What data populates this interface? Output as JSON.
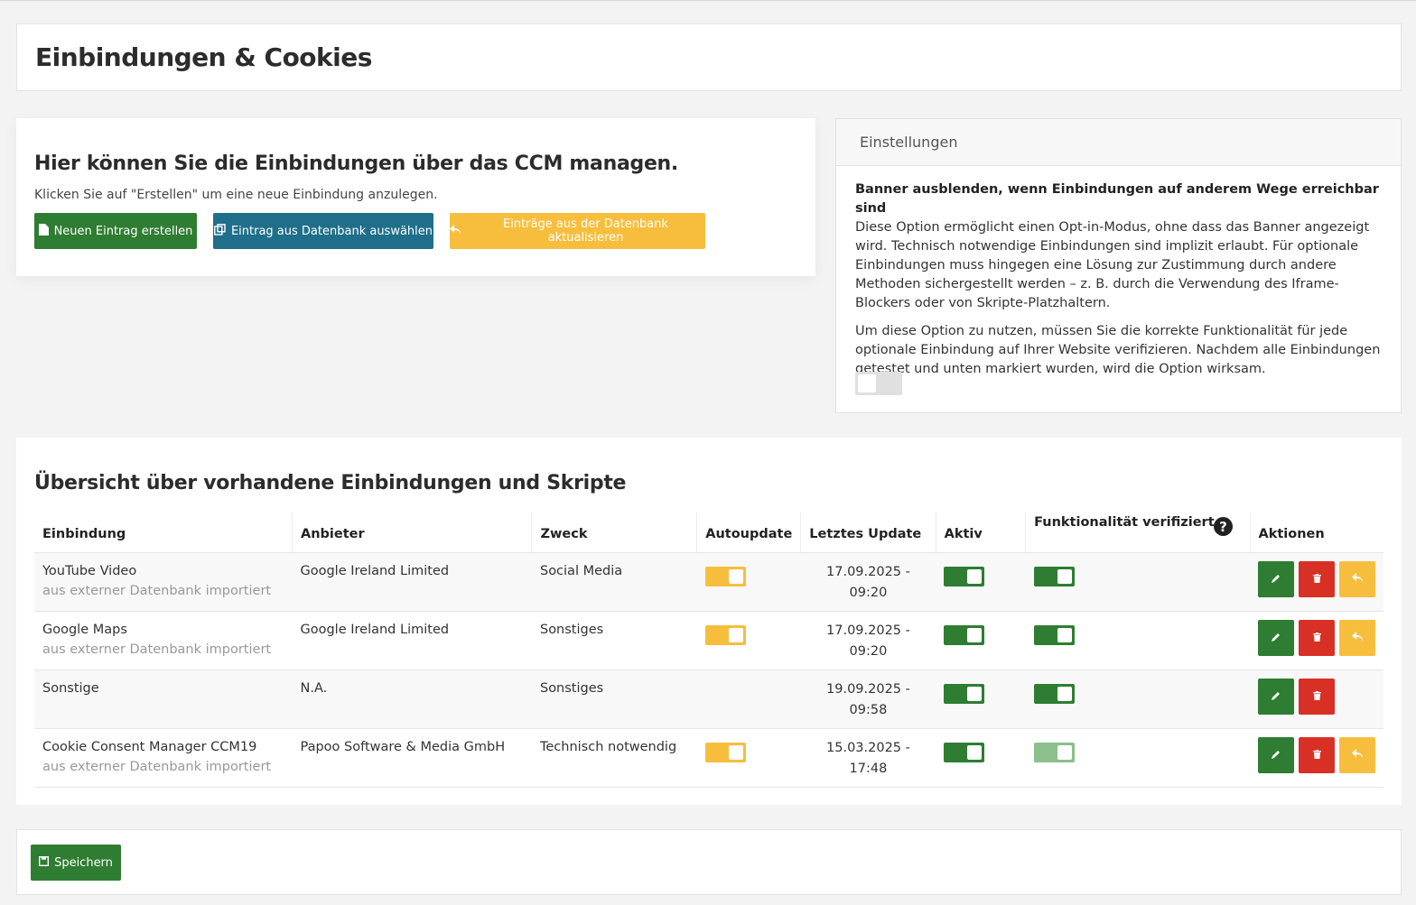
{
  "page": {
    "title": "Einbindungen & Cookies"
  },
  "intro": {
    "heading": "Hier können Sie die Einbindungen über das CCM managen.",
    "text": "Klicken Sie auf \"Erstellen\" um eine neue Einbindung anzulegen.",
    "buttons": {
      "new_entry": "Neuen Eintrag erstellen",
      "select_db": "Eintrag aus Datenbank auswählen",
      "update_db": "Einträge aus der Datenbank aktualisieren"
    }
  },
  "settings": {
    "title": "Einstellungen",
    "option_title": "Banner ausblenden, wenn Einbindungen auf anderem Wege erreichbar sind",
    "paragraph1": "Diese Option ermöglicht einen Opt-in-Modus, ohne dass das Banner angezeigt wird. Technisch notwendige Einbindungen sind implizit erlaubt. Für optionale Einbindungen muss hingegen eine Lösung zur Zustimmung durch andere Methoden sichergestellt werden – z. B. durch die Verwendung des Iframe-Blockers oder von Skripte-Platzhaltern.",
    "paragraph2": "Um diese Option zu nutzen, müssen Sie die korrekte Funktionalität für jede optionale Einbindung auf Ihrer Website verifizieren. Nachdem alle Einbindungen getestet und unten markiert wurden, wird die Option wirksam.",
    "toggle_on": false
  },
  "overview": {
    "heading": "Übersicht über vorhandene Einbindungen und Skripte",
    "columns": {
      "embed": "Einbindung",
      "provider": "Anbieter",
      "purpose": "Zweck",
      "autoupdate": "Autoupdate",
      "last_update": "Letztes Update",
      "active": "Aktiv",
      "verified": "Funktionalität verifiziert",
      "actions": "Aktionen"
    },
    "rows": [
      {
        "name": "YouTube Video",
        "sub": "aus externer Datenbank importiert",
        "provider": "Google Ireland Limited",
        "purpose": "Social Media",
        "autoupdate": true,
        "date": "17.09.2025 -",
        "time": "09:20",
        "active": true,
        "verified": true
      },
      {
        "name": "Google Maps",
        "sub": "aus externer Datenbank importiert",
        "provider": "Google Ireland Limited",
        "purpose": "Sonstiges",
        "autoupdate": true,
        "date": "17.09.2025 -",
        "time": "09:20",
        "active": true,
        "verified": true
      },
      {
        "name": "Sonstige",
        "sub": "",
        "provider": "N.A.",
        "purpose": "Sonstiges",
        "autoupdate": false,
        "date": "19.09.2025 -",
        "time": "09:58",
        "active": true,
        "verified": true
      },
      {
        "name": "Cookie Consent Manager CCM19",
        "sub": "aus externer Datenbank importiert",
        "provider": "Papoo Software & Media GmbH",
        "purpose": "Technisch notwendig",
        "autoupdate": true,
        "date": "15.03.2025 -",
        "time": "17:48",
        "active": true,
        "verified": true
      }
    ]
  },
  "footer": {
    "save_label": "Speichern"
  },
  "colors": {
    "green": "#2e7d32",
    "blue": "#1f6f8b",
    "yellow": "#f7be3e",
    "red": "#d93025"
  }
}
